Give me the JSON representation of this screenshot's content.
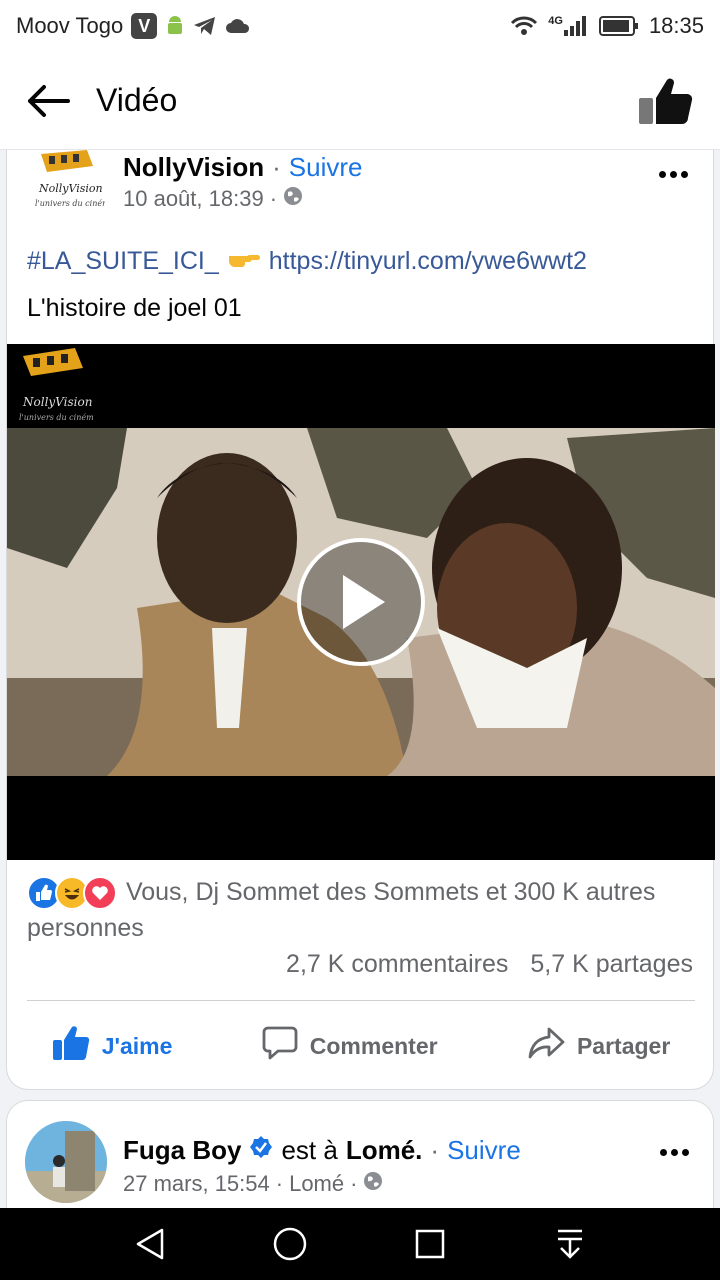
{
  "status_bar": {
    "carrier": "Moov Togo",
    "badge": "V",
    "network": "4G",
    "time": "18:35"
  },
  "app_bar": {
    "title": "Vidéo"
  },
  "post": {
    "author": "NollyVision",
    "separator": "·",
    "follow_label": "Suivre",
    "timestamp": "10 août, 18:39",
    "meta_separator": "·",
    "hashtag": "#LA_SUITE_ICI_",
    "link": "https://tinyurl.com/ywe6wwt2",
    "text": "L'histoire de joel 01",
    "reactions_text": "Vous, Dj Sommet des Sommets et 300 K autres personnes",
    "comments_count": "2,7 K commentaires",
    "shares_count": "5,7 K partages",
    "actions": {
      "like": "J'aime",
      "comment": "Commenter",
      "share": "Partager"
    }
  },
  "post2": {
    "author": "Fuga Boy",
    "checkin_text": "est à",
    "place": "Lomé.",
    "separator": "·",
    "follow_label": "Suivre",
    "timestamp": "27 mars, 15:54",
    "meta_separator": "·",
    "location": "Lomé",
    "meta_separator2": "·"
  },
  "colors": {
    "accent": "#1b74e4",
    "link": "#385898",
    "muted": "#65676b"
  }
}
